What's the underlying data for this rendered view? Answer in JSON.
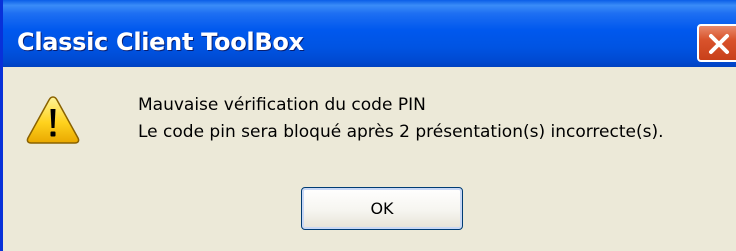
{
  "window": {
    "title": "Classic Client ToolBox"
  },
  "dialog": {
    "icon": "warning-icon",
    "message_line1": "Mauvaise vérification du code PIN",
    "message_line2": "Le code pin sera bloqué après 2 présentation(s) incorrecte(s).",
    "ok_label": "OK"
  },
  "colors": {
    "titlebar": "#0054e3",
    "dialog_bg": "#ece9d8",
    "close_button": "#d9532c"
  }
}
